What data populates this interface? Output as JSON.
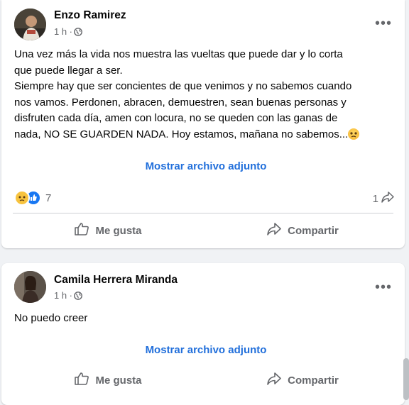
{
  "posts": [
    {
      "author": "Enzo Ramirez",
      "time": "1 h ·",
      "text_lines": [
        "Una vez más la vida nos muestra las vueltas que puede dar y lo corta",
        "que puede llegar a ser.",
        "Siempre hay que ser concientes de que venimos y no sabemos cuando",
        "nos vamos. Perdonen, abracen, demuestren, sean buenas personas y",
        "disfruten cada día, amen con locura, no se queden con las ganas de",
        "nada, NO SE GUARDEN NADA. Hoy estamos, mañana no sabemos..."
      ],
      "attachment_link": "Mostrar archivo adjunto",
      "reaction_count": "7",
      "share_count": "1",
      "like_label": "Me gusta",
      "share_label": "Compartir"
    },
    {
      "author": "Camila Herrera Miranda",
      "time": "1 h ·",
      "text_lines": [
        "No puedo creer"
      ],
      "attachment_link": "Mostrar archivo adjunto",
      "like_label": "Me gusta",
      "share_label": "Compartir"
    }
  ],
  "menu_icon": "more-dots-icon",
  "privacy_icon": "globe-icon",
  "colors": {
    "link": "#216fdb",
    "secondary_text": "#65676b",
    "like_blue": "#1877f2",
    "sad_yellow": "#f7c33f"
  }
}
